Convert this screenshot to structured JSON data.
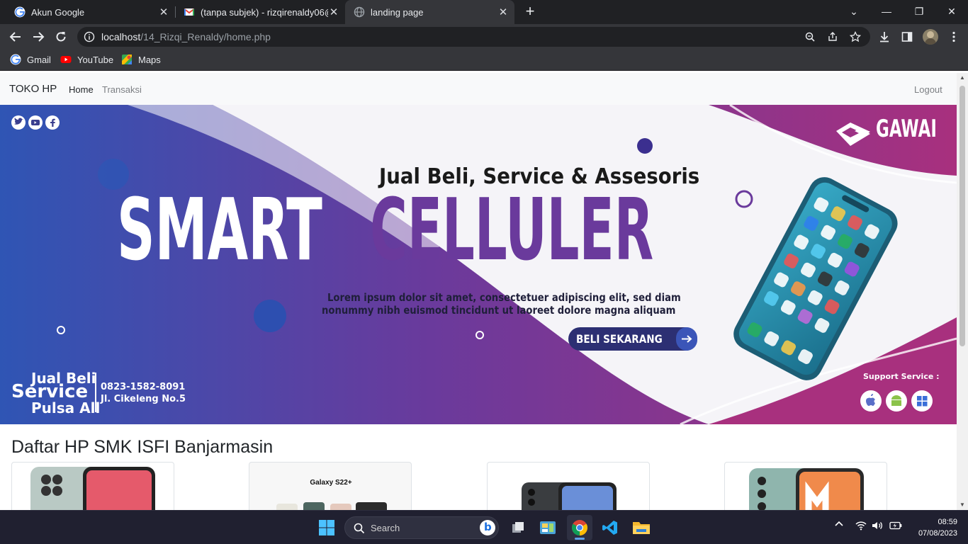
{
  "browser": {
    "tabs": [
      {
        "title": "Akun Google",
        "favicon": "google-icon"
      },
      {
        "title": "(tanpa subjek) - rizqirenaldy06@",
        "favicon": "gmail-icon"
      },
      {
        "title": "landing page",
        "favicon": "globe-icon"
      }
    ],
    "url_host": "localhost",
    "url_path": "/14_Rizqi_Renaldy/home.php",
    "bookmarks": [
      {
        "label": "Gmail",
        "icon": "google-icon"
      },
      {
        "label": "YouTube",
        "icon": "youtube-icon"
      },
      {
        "label": "Maps",
        "icon": "maps-icon"
      }
    ]
  },
  "site": {
    "brand": "TOKO HP",
    "nav": {
      "home": "Home",
      "transaksi": "Transaksi",
      "logout": "Logout"
    },
    "banner": {
      "logo_text": "GAWAI",
      "headline_small": "Jual Beli, Service & Assesoris",
      "headline_big_1": "SMART",
      "headline_big_2": "CELLULER",
      "lorem_1": "Lorem ipsum dolor sit amet, consectetuer adipiscing elit, sed diam",
      "lorem_2": "nonummy nibh euismod tincidunt ut laoreet dolore magna aliquam",
      "cta": "BELI SEKARANG",
      "left_1": "Jual Beli",
      "left_2": "Service",
      "left_3": "Pulsa All",
      "phone": "0823-1582-8091",
      "address": "Jl. Cikeleng No.5",
      "support": "Support Service :"
    },
    "list_title": "Daftar HP SMK ISFI Banjarmasin",
    "products": [
      {
        "caption": ""
      },
      {
        "caption": "Galaxy S22+"
      },
      {
        "caption": ""
      },
      {
        "caption": ""
      }
    ]
  },
  "taskbar": {
    "search_label": "Search",
    "time": "08:59",
    "date": "07/08/2023"
  }
}
